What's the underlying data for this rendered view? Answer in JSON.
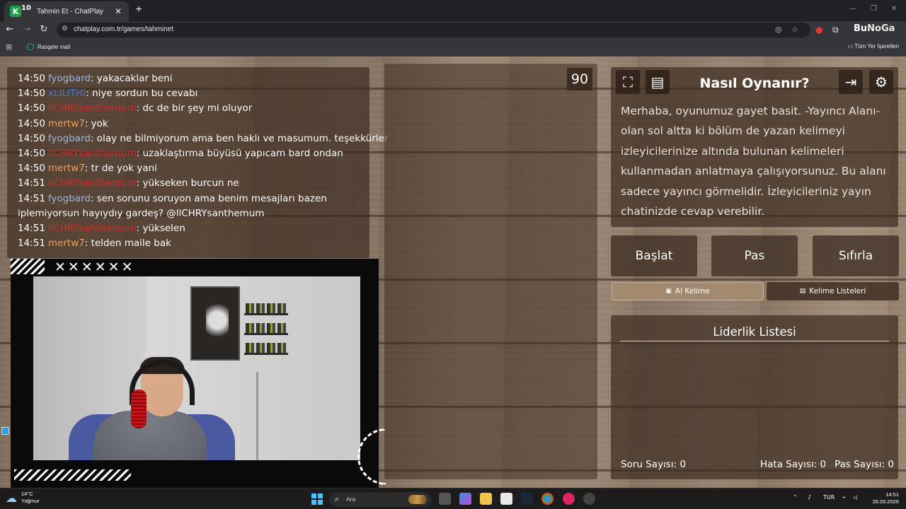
{
  "browser": {
    "tab_title": "Tahmin Et - ChatPlay",
    "tab_badge": "10",
    "favicon_letter": "K",
    "url": "chatplay.com.tr/games/tahminet",
    "bookmark": "Rasgele mail",
    "all_bookmarks": "Tüm Yer İşaretleri",
    "profile_logo_a": "Bu",
    "profile_logo_b": "NoGa"
  },
  "chat": {
    "messages": [
      {
        "time": "14:50",
        "user": "fyogbard",
        "color": "#9bb7e0",
        "text": ": yakacaklar beni"
      },
      {
        "time": "14:50",
        "user": "xLILITHI",
        "color": "#3b78d8",
        "text": ": niye sordun bu cevabı"
      },
      {
        "time": "14:50",
        "user": "llCHRYsanthemum",
        "color": "#d42a2a",
        "text": ": dc de bir şey mi oluyor"
      },
      {
        "time": "14:50",
        "user": "mertw7",
        "color": "#f0a25a",
        "text": ": yok"
      },
      {
        "time": "14:50",
        "user": "fyogbard",
        "color": "#9bb7e0",
        "text": ": olay ne bilmiyorum ama ben haklı ve masumum. teşekkürler"
      },
      {
        "time": "14:50",
        "user": "llCHRYsanthemum",
        "color": "#d42a2a",
        "text": ": uzaklaştırma büyüsü yapıcam bard ondan"
      },
      {
        "time": "14:50",
        "user": "mertw7",
        "color": "#f0a25a",
        "text": ": tr de yok yani"
      },
      {
        "time": "14:51",
        "user": "llCHRYsanthemum",
        "color": "#d42a2a",
        "text": ": yükseken burcun ne"
      },
      {
        "time": "14:51",
        "user": "fyogbard",
        "color": "#9bb7e0",
        "text": ": sen sorunu soruyon ama benim mesajları bazen iplemiyorsun hayıydıy gardeş? @llCHRYsanthemum"
      },
      {
        "time": "14:51",
        "user": "llCHRYsanthemum",
        "color": "#d42a2a",
        "text": ": yükselen"
      },
      {
        "time": "14:51",
        "user": "mertw7",
        "color": "#f0a25a",
        "text": ": telden maile bak"
      }
    ]
  },
  "webcam": {
    "marks": "✕✕✕✕✕✕"
  },
  "game": {
    "timer": "90",
    "howto_title": "Nasıl Oynanır?",
    "howto_text": "Merhaba, oyunumuz gayet basit. -Yayıncı Alanı- olan sol altta ki bölüm de yazan kelimeyi izleyicilerinize altında bulunan kelimeleri kullanmadan anlatmaya çalışıyorsunuz. Bu alanı sadece yayıncı görmelidir. İzleyicileriniz yayın chatinizde cevap verebilir.",
    "buttons": {
      "start": "Başlat",
      "pass": "Pas",
      "reset": "Sıfırla"
    },
    "ai_word": "AI Kelime",
    "word_lists": "Kelime Listeleri",
    "leaderboard_title": "Liderlik Listesi",
    "stats": {
      "questions_label": "Soru Sayısı:",
      "questions_value": "0",
      "errors_label": "Hata Sayısı:",
      "errors_value": "0",
      "passes_label": "Pas Sayısı:",
      "passes_value": "0"
    }
  },
  "taskbar": {
    "temperature": "14°C",
    "weather": "Yağmur",
    "search_placeholder": "Ara",
    "language": "TUR",
    "time": "14:51",
    "date": "28.03.2026"
  },
  "colors": {
    "chat_panel": "#3e2e22",
    "ai_button": "#a2896f",
    "accent_blue": "#4cc2ff"
  }
}
